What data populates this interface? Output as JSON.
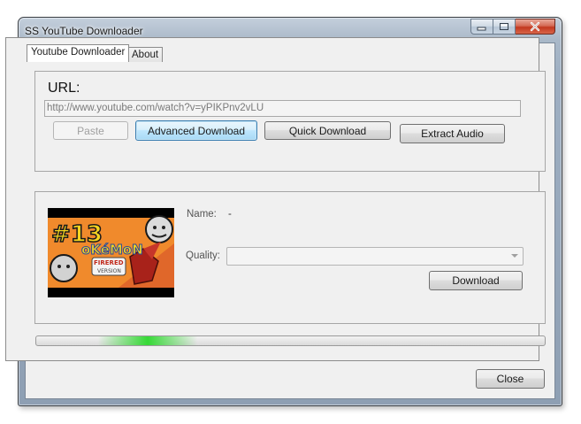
{
  "window": {
    "title": "SS YouTube Downloader"
  },
  "caption_buttons": [
    {
      "name": "minimize-button",
      "icon": "minimize-icon"
    },
    {
      "name": "maximize-button",
      "icon": "maximize-icon"
    },
    {
      "name": "close-window-button",
      "icon": "close-icon"
    }
  ],
  "tabs": [
    {
      "label": "Youtube Downloader",
      "active": true
    },
    {
      "label": "About",
      "active": false
    }
  ],
  "url_section": {
    "label": "URL:",
    "url_value": "http://www.youtube.com/watch?v=yPIKPnv2vLU",
    "buttons": {
      "paste": "Paste",
      "advanced_download": "Advanced Download",
      "quick_download": "Quick Download",
      "extract_audio": "Extract Audio"
    }
  },
  "video_info": {
    "thumbnail_icon": "video-thumbnail",
    "name_label": "Name:",
    "name_value": "-",
    "quality_label": "Quality:",
    "quality_selected": "",
    "download_label": "Download"
  },
  "progress": {
    "style": "marquee"
  },
  "footer": {
    "close_label": "Close"
  },
  "colors": {
    "accent_focus": "#3c7fb1",
    "progress_green": "#36d936",
    "close_red": "#c2381f"
  }
}
